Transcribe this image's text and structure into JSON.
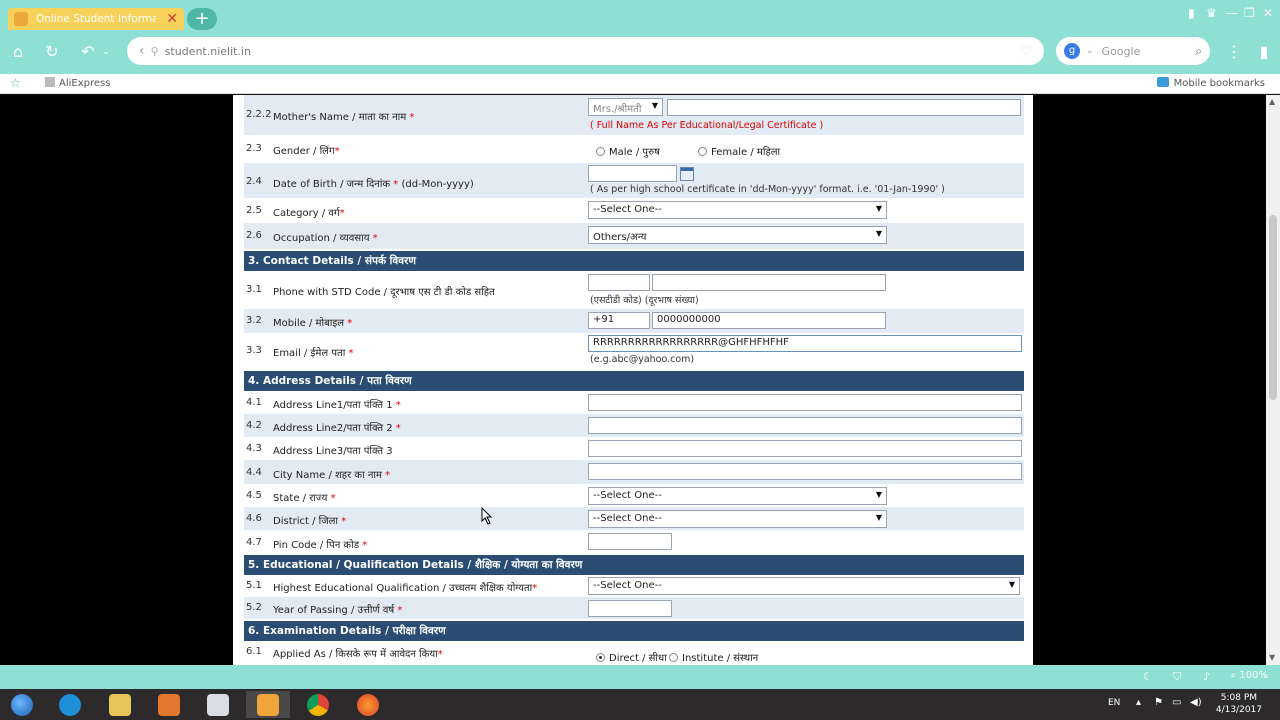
{
  "browser": {
    "tab_title": "Online Student Information",
    "url": "student.nielit.in",
    "search_placeholder": "Google",
    "bookmarks": {
      "aliexpress": "AliExpress",
      "mobile": "Mobile bookmarks"
    },
    "zoom": "100%"
  },
  "form": {
    "r222": {
      "num": "2.2.2",
      "label": "Mother's Name / माता का नाम ",
      "req": "*",
      "title_select": "Mrs./श्रीमती",
      "hint": "( Full Name As Per Educational/Legal Certificate )"
    },
    "r23": {
      "num": "2.3",
      "label": "Gender / लिंग",
      "req": "*",
      "male": "Male / पुरुष",
      "female": "Female / महिला"
    },
    "r24": {
      "num": "2.4",
      "label": "Date of Birth / जन्म दिनांक ",
      "req": "*",
      "suffix": " (dd-Mon-yyyy)",
      "hint": "( As per high school certificate in 'dd-Mon-yyyy' format. i.e. '01-Jan-1990' )"
    },
    "r25": {
      "num": "2.5",
      "label": "Category / वर्ग",
      "req": "*",
      "value": "--Select One--"
    },
    "r26": {
      "num": "2.6",
      "label": "Occupation / व्यवसाय ",
      "req": "*",
      "value": "Others/अन्य"
    },
    "s3": "3. Contact Details / संपर्क विवरण",
    "r31": {
      "num": "3.1",
      "label": "Phone with STD Code / दूरभाष एस टी डी कोड सहित",
      "hint": "(एसटीडी कोड) (दूरभाष संख्या)"
    },
    "r32": {
      "num": "3.2",
      "label": "Mobile / मोबाइल ",
      "req": "*",
      "code": "+91",
      "value": "0000000000"
    },
    "r33": {
      "num": "3.3",
      "label": "Email / ईमेल पता ",
      "req": "*",
      "value": "RRRRRRRRRRRRRRRRRR@GHFHFHFHF",
      "hint": "(e.g.abc@yahoo.com)"
    },
    "s4": "4. Address Details / पता विवरण",
    "r41": {
      "num": "4.1",
      "label": "Address Line1/पता पंक्ति 1 ",
      "req": "*"
    },
    "r42": {
      "num": "4.2",
      "label": "Address Line2/पता पंक्ति 2 ",
      "req": "*"
    },
    "r43": {
      "num": "4.3",
      "label": "Address Line3/पता पंक्ति 3"
    },
    "r44": {
      "num": "4.4",
      "label": "City Name / शहर का नाम ",
      "req": "*"
    },
    "r45": {
      "num": "4.5",
      "label": "State / राज्य ",
      "req": "*",
      "value": "--Select One--"
    },
    "r46": {
      "num": "4.6",
      "label": "District / जिला ",
      "req": "*",
      "value": "--Select One--"
    },
    "r47": {
      "num": "4.7",
      "label": "Pin Code / पिन कोड ",
      "req": "*"
    },
    "s5": "5. Educational / Qualification Details / शैक्षिक / योग्यता का विवरण",
    "r51": {
      "num": "5.1",
      "label": "Highest Educational Qualification / उच्चतम शैक्षिक योग्यता",
      "req": "*",
      "value": "--Select One--"
    },
    "r52": {
      "num": "5.2",
      "label": "Year of Passing / उत्तीर्ण वर्ष ",
      "req": "*"
    },
    "s6": "6. Examination Details / परीक्षा विवरण",
    "r61": {
      "num": "6.1",
      "label": "Applied As / किसके रूप में आवेदन किया",
      "req": "*",
      "direct": "Direct / सीधा",
      "institute": "Institute / संस्थान"
    }
  },
  "taskbar": {
    "lang": "EN",
    "time": "5:08 PM",
    "date": "4/13/2017"
  }
}
